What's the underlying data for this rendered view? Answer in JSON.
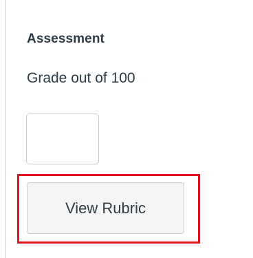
{
  "assessment": {
    "heading": "Assessment",
    "grade_label": "Grade out of 100",
    "grade_value": "",
    "view_rubric_label": "View Rubric",
    "highlight_color": "#e0141e"
  }
}
